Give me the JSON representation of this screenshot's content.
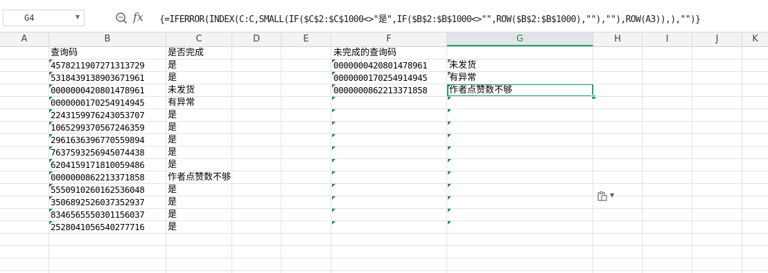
{
  "formula_bar": {
    "name_box": "G4",
    "zoom_icon": "zoom-formula-icon",
    "fx_label": "fx",
    "formula": "{=IFERROR(INDEX(C:C,SMALL(IF($C$2:$C$1000<>\"是\",IF($B$2:$B$1000<>\"\",ROW($B$2:$B$1000),\"\"),\"\"),ROW(A3)),),\"\")}"
  },
  "column_headers": [
    "A",
    "B",
    "C",
    "D",
    "E",
    "F",
    "G",
    "H",
    "I",
    "J",
    "K"
  ],
  "selected_column": "G",
  "selected_cell": "G4",
  "cells": {
    "B1": "查询码",
    "C1": "是否完成",
    "F1": "未完成的查询码",
    "B": [
      "4578211907271313729",
      "5318439138903671961",
      "0000000420801478961",
      "0000000170254914945",
      "2243159976243053707",
      "1065299370567246359",
      "2961636396770559894",
      "7637593256945074438",
      "6204159171810059486",
      "0000000862213371858",
      "5550910260162536048",
      "3506892526037352937",
      "8346565550301156037",
      "2528041056540277716"
    ],
    "C": [
      "是",
      "是",
      "未发货",
      "有异常",
      "是",
      "是",
      "是",
      "是",
      "是",
      "作者点赞数不够",
      "是",
      "是",
      "是",
      "是"
    ],
    "F": [
      "0000000420801478961",
      "0000000170254914945",
      "0000000862213371858"
    ],
    "G": [
      "未发货",
      "有异常",
      "作者点赞数不够"
    ]
  },
  "paste_options_icon": "paste-options-icon",
  "colors": {
    "accent": "#21a366",
    "text_marker": "#1c8c4f",
    "grid": "#e2e2e2"
  }
}
